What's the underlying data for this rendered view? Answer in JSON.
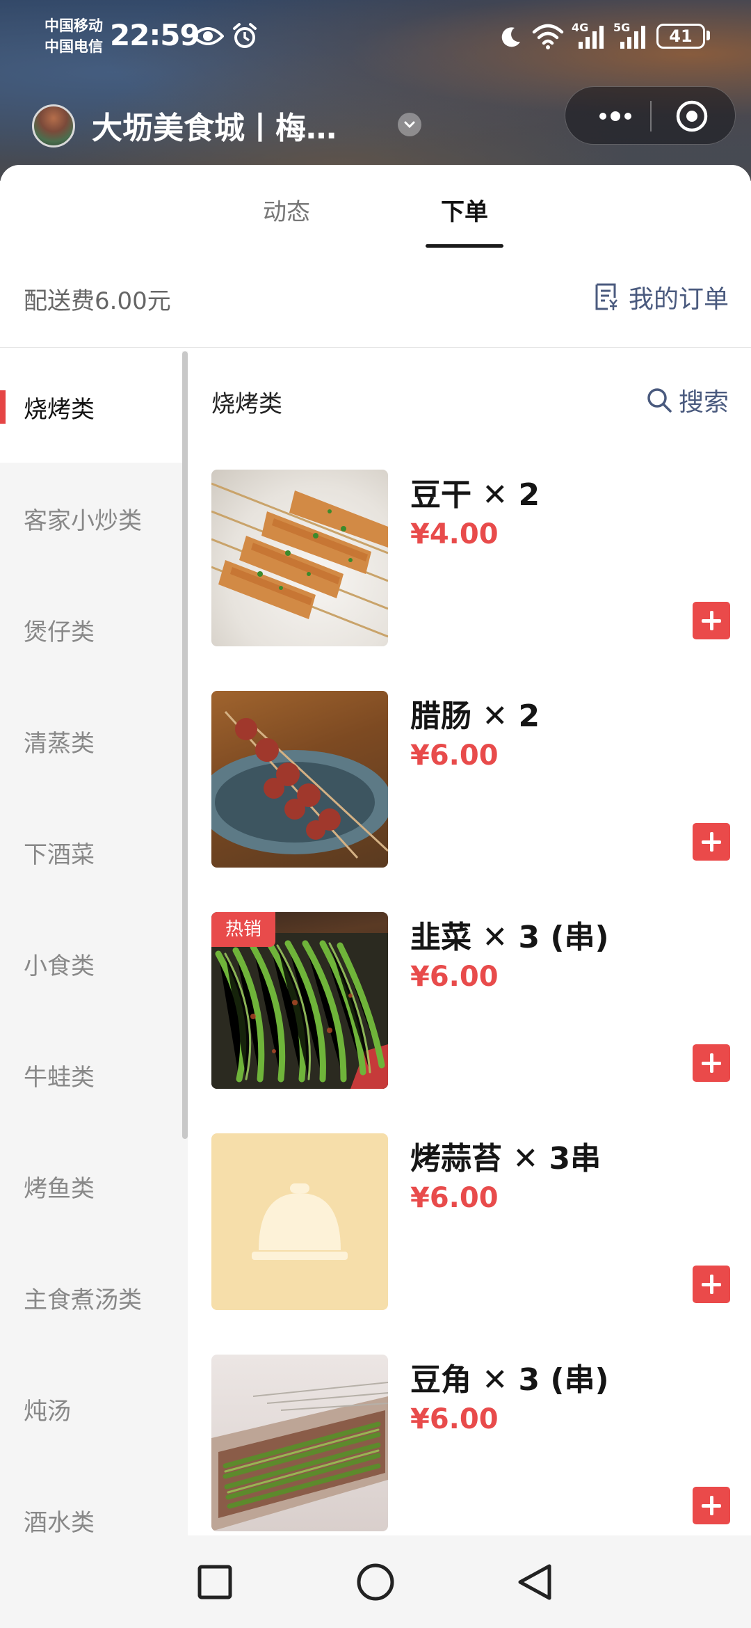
{
  "status_bar": {
    "carrier_1": "中国移动",
    "carrier_2": "中国电信",
    "time": "22:59",
    "signal_1": "4G",
    "signal_2": "5G",
    "battery": "41"
  },
  "title_bar": {
    "store_name": "大坜美食城丨梅…"
  },
  "tabs": [
    {
      "label": "动态",
      "active": false
    },
    {
      "label": "下单",
      "active": true
    }
  ],
  "info": {
    "delivery_fee": "配送费6.00元",
    "my_orders": "我的订单"
  },
  "categories": [
    {
      "label": "烧烤类",
      "active": true
    },
    {
      "label": "客家小炒类",
      "active": false
    },
    {
      "label": "煲仔类",
      "active": false
    },
    {
      "label": "清蒸类",
      "active": false
    },
    {
      "label": "下酒菜",
      "active": false
    },
    {
      "label": "小食类",
      "active": false
    },
    {
      "label": "牛蛙类",
      "active": false
    },
    {
      "label": "烤鱼类",
      "active": false
    },
    {
      "label": "主食煮汤类",
      "active": false
    },
    {
      "label": "炖汤",
      "active": false
    },
    {
      "label": "酒水类",
      "active": false
    }
  ],
  "list": {
    "section_title": "烧烤类",
    "search_label": "搜索"
  },
  "products": [
    {
      "name": "豆干 ✕ 2",
      "price": "¥4.00",
      "image": "skewered-tofu-photo"
    },
    {
      "name": "腊肠 ✕ 2",
      "price": "¥6.00",
      "image": "sausage-skewer-photo"
    },
    {
      "name": "韭菜  ✕ 3 (串)",
      "price": "¥6.00",
      "image": "chive-skewer-photo",
      "badge": "热销"
    },
    {
      "name": "烤蒜苔 ✕ 3串",
      "price": "¥6.00",
      "image": "placeholder-cloche-icon"
    },
    {
      "name": "豆角 ✕ 3 (串)",
      "price": "¥6.00",
      "image": "bean-skewer-photo"
    }
  ],
  "nav": {
    "icons": [
      "recents-square-icon",
      "home-circle-icon",
      "back-triangle-icon"
    ]
  },
  "colors": {
    "accent_red": "#e84b4b",
    "link_blue": "#4a5a7e"
  }
}
